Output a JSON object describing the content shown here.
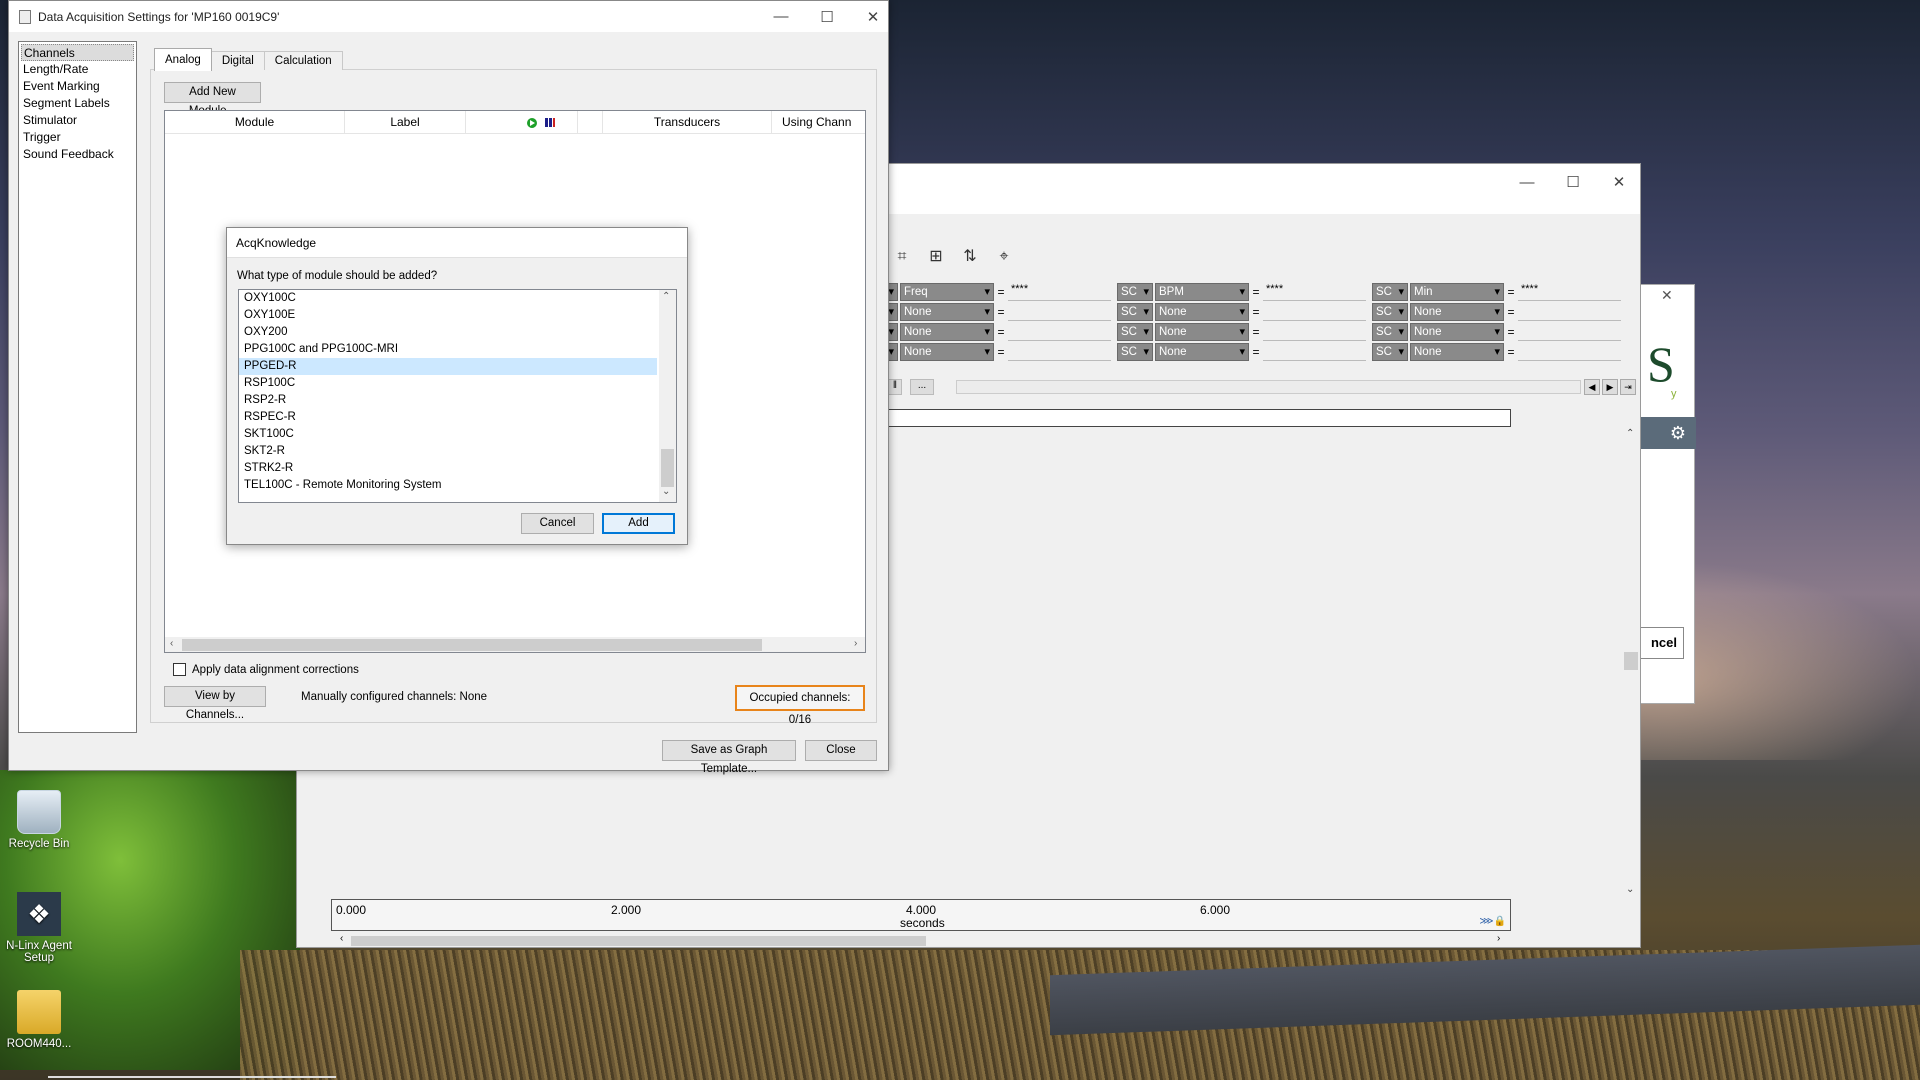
{
  "desktop": {
    "icons": [
      {
        "label": "Recycle Bin"
      },
      {
        "label": "N-Linx Agent Setup"
      },
      {
        "label": "ROOM440..."
      }
    ]
  },
  "main_dialog": {
    "title": "Data Acquisition Settings for 'MP160 0019C9'",
    "caption": {
      "minimize": "—",
      "maximize": "☐",
      "close": "✕"
    },
    "nav_items": [
      "Channels",
      "Length/Rate",
      "Event Marking",
      "Segment Labels",
      "Stimulator",
      "Trigger",
      "Sound Feedback"
    ],
    "selected_nav": "Channels",
    "tabs": [
      "Analog",
      "Digital",
      "Calculation"
    ],
    "active_tab": "Analog",
    "add_module_button": "Add New Module...",
    "table_columns": [
      "Module",
      "Label",
      "",
      "Transducers",
      "Using Chann"
    ],
    "apply_alignment_label": "Apply data alignment corrections",
    "apply_alignment_checked": false,
    "view_by_channels_button": "View by Channels...",
    "manual_channels_label": "Manually configured channels: None",
    "occupied_channels_label": "Occupied channels: 0/16",
    "save_template_button": "Save as Graph Template...",
    "close_button": "Close"
  },
  "modal": {
    "title": "AcqKnowledge",
    "prompt": "What type of module should be added?",
    "options": [
      "OXY100C",
      "OXY100E",
      "OXY200",
      "PPG100C and PPG100C-MRI",
      "PPGED-R",
      "RSP100C",
      "RSP2-R",
      "RSPEC-R",
      "SKT100C",
      "SKT2-R",
      "STRK2-R",
      "TEL100C - Remote Monitoring System"
    ],
    "selected_option": "PPGED-R",
    "cancel_button": "Cancel",
    "add_button": "Add"
  },
  "graph_window": {
    "measurements": [
      [
        {
          "type": "Freq",
          "ch": "SC",
          "value": "****"
        },
        {
          "type": "BPM",
          "ch": "SC",
          "value": "****"
        },
        {
          "type": "Min",
          "ch": "",
          "value": "****"
        }
      ],
      [
        {
          "type": "None",
          "ch": "SC",
          "value": ""
        },
        {
          "type": "None",
          "ch": "SC",
          "value": ""
        },
        {
          "type": "None",
          "ch": "",
          "value": ""
        }
      ],
      [
        {
          "type": "None",
          "ch": "SC",
          "value": ""
        },
        {
          "type": "None",
          "ch": "SC",
          "value": ""
        },
        {
          "type": "None",
          "ch": "",
          "value": ""
        }
      ],
      [
        {
          "type": "None",
          "ch": "SC",
          "value": ""
        },
        {
          "type": "None",
          "ch": "SC",
          "value": ""
        },
        {
          "type": "None",
          "ch": "",
          "value": ""
        }
      ]
    ],
    "min_channel_label": "SC",
    "equals": "=",
    "scroll_button_label": "...",
    "axis_ticks": [
      "0.000",
      "2.000",
      "4.000",
      "6.000"
    ],
    "axis_unit": "seconds"
  },
  "side_window": {
    "logo_letter": "S",
    "logo_tail": "y",
    "cancel_fragment": "ncel"
  }
}
